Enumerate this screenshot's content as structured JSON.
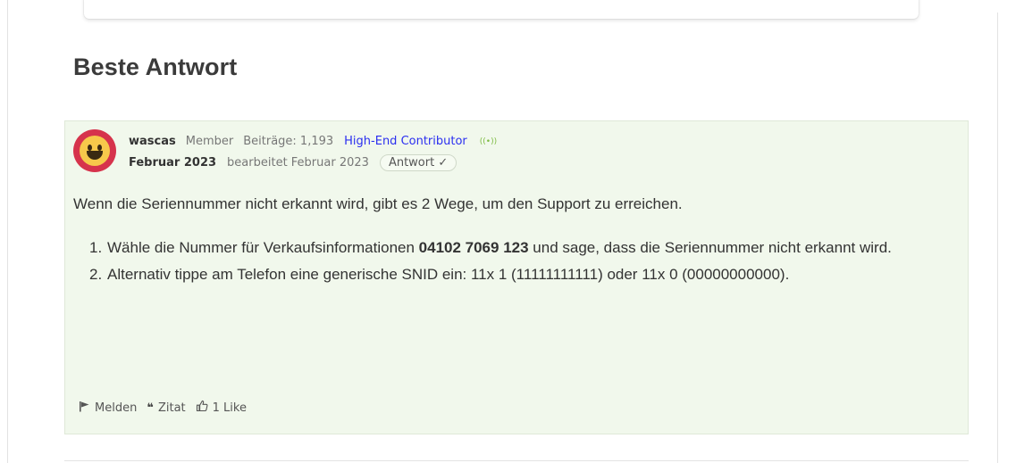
{
  "section": {
    "title": "Beste Antwort"
  },
  "post": {
    "author": {
      "username": "wascas",
      "role": "Member",
      "posts": "Beiträge: 1,193",
      "rank": "High-End Contributor",
      "rank_badge_icon": "signal-icon",
      "avatar_icon": "smiley-avatar",
      "avatar_color": "#d6334c"
    },
    "date": "Februar 2023",
    "edited": "bearbeitet Februar 2023",
    "answer_badge": "Antwort ✓",
    "intro": "Wenn die Seriennummer nicht erkannt wird, gibt es 2 Wege, um den Support zu erreichen.",
    "steps": [
      {
        "number": "1.",
        "before": "Wähle die Nummer für Verkaufsinformationen ",
        "highlight": "04102 7069 123",
        "after": " und sage, dass die Seriennummer nicht erkannt wird."
      },
      {
        "number": "2.",
        "text": "Alternativ tippe am Telefon eine generische SNID ein: 11x 1 (11111111111) oder 11x 0 (00000000000)."
      }
    ],
    "actions": {
      "report": {
        "icon": "flag-icon",
        "label": "Melden"
      },
      "quote": {
        "icon": "quote-icon",
        "label": "Zitat"
      },
      "like": {
        "icon": "thumbs-up-icon",
        "label": "1 Like"
      }
    },
    "colors": {
      "card_background": "#f1f8ec",
      "rank_color": "#2b2ff0"
    }
  }
}
